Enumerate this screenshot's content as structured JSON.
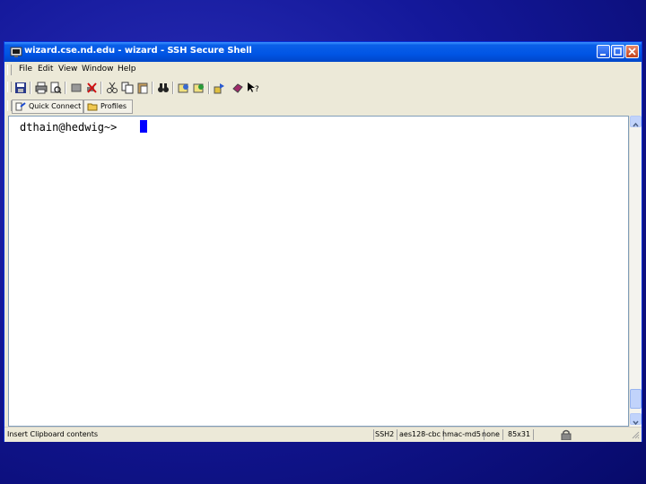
{
  "window": {
    "title": "wizard.cse.nd.edu - wizard - SSH Secure Shell"
  },
  "menu": {
    "items": [
      "File",
      "Edit",
      "View",
      "Window",
      "Help"
    ]
  },
  "toolbar2": {
    "quick_connect": "Quick Connect",
    "profiles": "Profiles"
  },
  "terminal": {
    "prompt": "dthain@hedwig~>"
  },
  "status": {
    "hint": "Insert Clipboard contents",
    "protocol": "SSH2",
    "cipher": "aes128-cbc",
    "mac": "hmac-md5",
    "compression": "none",
    "size": "85x31"
  },
  "colors": {
    "desktop": "#14189a",
    "titlebar": "#0055e5",
    "cursor": "#0000ff"
  }
}
